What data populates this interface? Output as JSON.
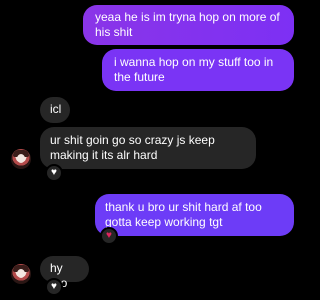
{
  "messages": {
    "sent_1": "yeaa he is im tryna hop on more of his shit",
    "sent_2": "i wanna hop on my stuff too in the future",
    "recv_1": "icl",
    "recv_2": "ur shit goin go so crazy js keep making it its alr hard",
    "sent_3": "thank u bro ur shit hard af too gotta keep working tgt",
    "recv_3": "hy bro"
  },
  "reactions": {
    "recv_2_reaction": "white-heart",
    "sent_3_reaction": "red-heart",
    "recv_3_reaction": "white-heart"
  },
  "colors": {
    "background": "#000000",
    "sent_bubble": "#7b2ff7",
    "received_bubble": "#262626",
    "red_heart": "#e0245e"
  }
}
